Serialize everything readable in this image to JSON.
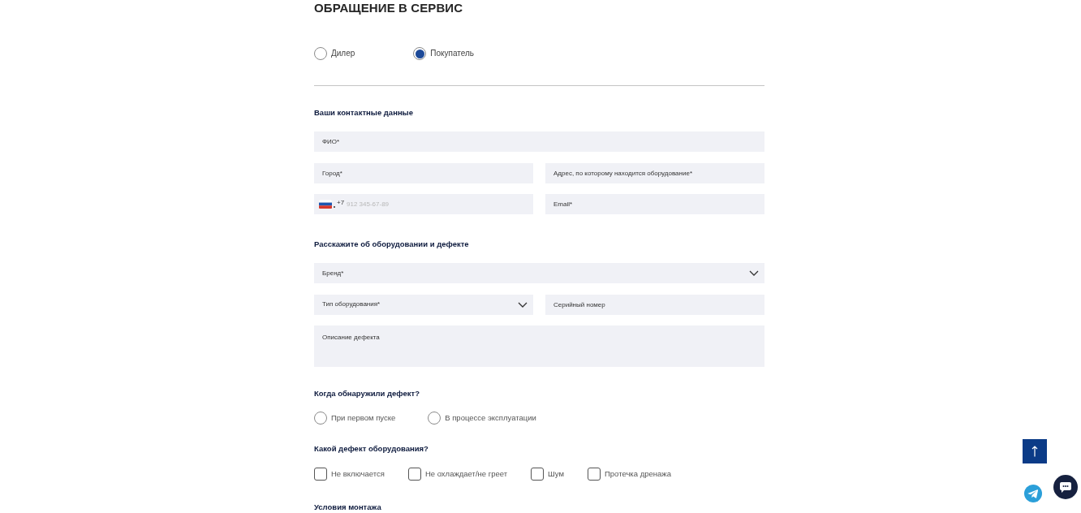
{
  "title": "ОБРАЩЕНИЕ В СЕРВИС",
  "requester_type": [
    {
      "label": "Дилер",
      "selected": false
    },
    {
      "label": "Покупатель",
      "selected": true
    }
  ],
  "sections": [
    {
      "heading": "Ваши контактные данные",
      "rows": [
        [
          {
            "kind": "text",
            "placeholder": "ФИО*"
          }
        ],
        [
          {
            "kind": "text",
            "placeholder": "Город*"
          },
          {
            "kind": "text",
            "placeholder": "Адрес, по которому находится оборудование*"
          }
        ],
        [
          {
            "kind": "phone",
            "prefix": "+7",
            "placeholder": "912 345-67-89"
          },
          {
            "kind": "text",
            "placeholder": "Email*"
          }
        ]
      ]
    },
    {
      "heading": "Расскажите об оборудовании и дефекте",
      "rows": [
        [
          {
            "kind": "select",
            "placeholder": "Бренд*"
          }
        ],
        [
          {
            "kind": "select",
            "placeholder": "Тип оборудования*"
          },
          {
            "kind": "text",
            "placeholder": "Серийный номер"
          }
        ],
        [
          {
            "kind": "textarea",
            "placeholder": "Описание дефекта"
          }
        ]
      ]
    }
  ],
  "questions": [
    {
      "heading": "Когда обнаружили дефект?",
      "kind": "radio",
      "options": [
        {
          "label": "При первом пуске",
          "selected": false
        },
        {
          "label": "В процессе эксплуатации",
          "selected": false
        }
      ]
    },
    {
      "heading": "Какой дефект оборудования?",
      "kind": "checkbox",
      "options": [
        {
          "label": "Не включается",
          "checked": false
        },
        {
          "label": "Не охлаждает/не греет",
          "checked": false
        },
        {
          "label": "Шум",
          "checked": false
        },
        {
          "label": "Протечка дренажа",
          "checked": false
        }
      ]
    }
  ],
  "next_section": {
    "heading": "Условия монтажа"
  }
}
